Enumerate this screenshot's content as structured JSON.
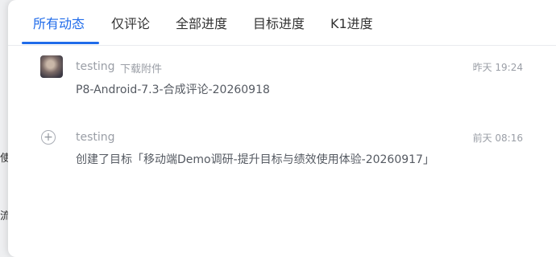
{
  "background": {
    "fragments": [
      "使",
      "流"
    ]
  },
  "tabs": [
    {
      "label": "所有动态",
      "active": true
    },
    {
      "label": "仅评论",
      "active": false
    },
    {
      "label": "全部进度",
      "active": false
    },
    {
      "label": "目标进度",
      "active": false
    },
    {
      "label": "K1进度",
      "active": false
    }
  ],
  "activities": [
    {
      "author": "testing",
      "action": "下载附件",
      "time": "昨天 19:24",
      "content": "P8-Android-7.3-合成评论-20260918",
      "icon": "user-avatar"
    },
    {
      "author": "testing",
      "action": "",
      "time": "前天 08:16",
      "content": "创建了目标「移动端Demo调研-提升目标与绩效使用体验-20260917」",
      "icon": "plus-circle-icon"
    }
  ],
  "colors": {
    "accent": "#1f6bea",
    "text": "#333333",
    "muted": "#9a9ea6"
  }
}
